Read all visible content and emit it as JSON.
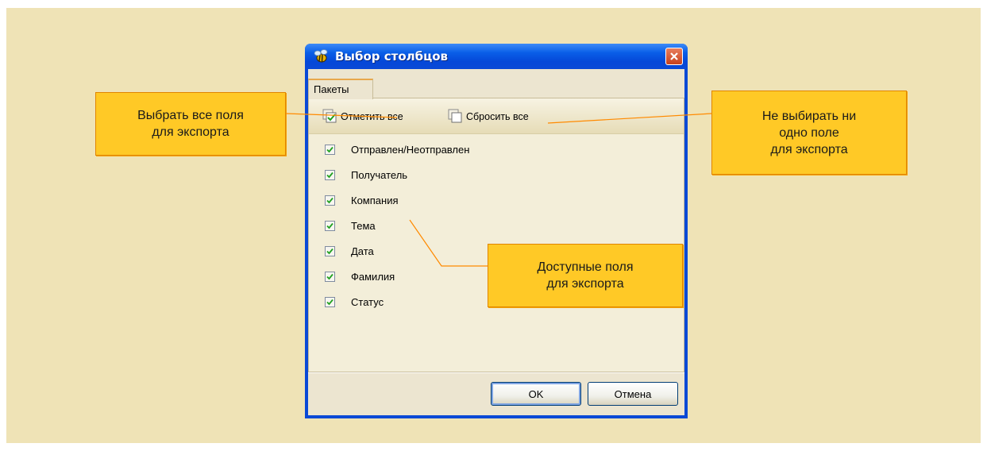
{
  "window": {
    "title": "Выбор столбцов"
  },
  "tabs": [
    {
      "label": "Пакеты",
      "active": true
    }
  ],
  "toolbar": {
    "select_all_label": "Отметить все",
    "reset_all_label": "Сбросить все"
  },
  "fields": [
    {
      "label": "Отправлен/Неотправлен",
      "checked": true
    },
    {
      "label": "Получатель",
      "checked": true
    },
    {
      "label": "Компания",
      "checked": true
    },
    {
      "label": "Тема",
      "checked": true
    },
    {
      "label": "Дата",
      "checked": true
    },
    {
      "label": "Фамилия",
      "checked": true
    },
    {
      "label": "Статус",
      "checked": true
    }
  ],
  "buttons": {
    "ok_label": "OK",
    "cancel_label": "Отмена"
  },
  "callouts": {
    "select_all": "Выбрать все поля\nдля экспорта",
    "reset_all": "Не выбирать ни\nодно поле\nдля экспорта",
    "fields": "Доступные поля\nдля экспорта"
  },
  "colors": {
    "page_background": "#efe3b6",
    "callout_fill": "#ffc926",
    "callout_border": "#e08500",
    "title_bar": "#0a49d6",
    "checkmark": "#21a121"
  }
}
